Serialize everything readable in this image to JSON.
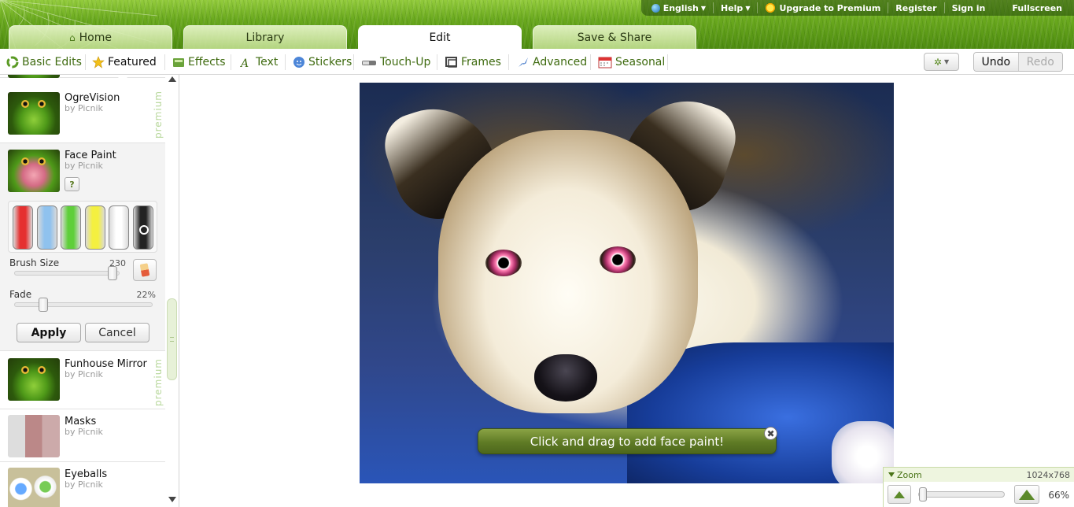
{
  "topnav": {
    "language": "English",
    "help": "Help",
    "upgrade": "Upgrade to Premium",
    "register": "Register",
    "signin": "Sign in",
    "fullscreen": "Fullscreen"
  },
  "maintabs": [
    {
      "label": "Home",
      "icon": "home-icon"
    },
    {
      "label": "Library"
    },
    {
      "label": "Edit",
      "active": true
    },
    {
      "label": "Save & Share"
    }
  ],
  "subnav": [
    {
      "label": "Basic Edits",
      "icon": "basic-edits-icon"
    },
    {
      "label": "Featured",
      "icon": "star-icon",
      "active": true
    },
    {
      "label": "Effects",
      "icon": "effects-icon"
    },
    {
      "label": "Text",
      "icon": "text-icon"
    },
    {
      "label": "Stickers",
      "icon": "stickers-icon"
    },
    {
      "label": "Touch-Up",
      "icon": "touch-up-icon"
    },
    {
      "label": "Frames",
      "icon": "frames-icon"
    },
    {
      "label": "Advanced",
      "icon": "advanced-icon"
    },
    {
      "label": "Seasonal",
      "icon": "calendar-icon"
    }
  ],
  "toolbar": {
    "undo": "Undo",
    "redo": "Redo",
    "settings_icon": "gear-icon"
  },
  "panel": {
    "items": [
      {
        "name": "OgreVision",
        "by": "by Picnik",
        "premium": "premium"
      },
      {
        "name": "Face Paint",
        "by": "by Picnik"
      },
      {
        "name": "Funhouse Mirror",
        "by": "by Picnik",
        "premium": "premium"
      },
      {
        "name": "Masks",
        "by": "by Picnik"
      },
      {
        "name": "Eyeballs",
        "by": "by Picnik"
      }
    ],
    "help_label": "?",
    "colors": [
      "#e53030",
      "#8fc2ee",
      "#5fcf3a",
      "#f4f040",
      "#ffffff",
      "#222222"
    ],
    "brush_size_label": "Brush Size",
    "brush_size_value": "230",
    "fade_label": "Fade",
    "fade_value": "22%",
    "apply": "Apply",
    "cancel": "Cancel"
  },
  "canvas": {
    "tip": "Click and drag to add face paint!",
    "tip_close": "✖"
  },
  "zoom": {
    "label": "Zoom",
    "dimensions": "1024x768",
    "percent": "66%"
  }
}
